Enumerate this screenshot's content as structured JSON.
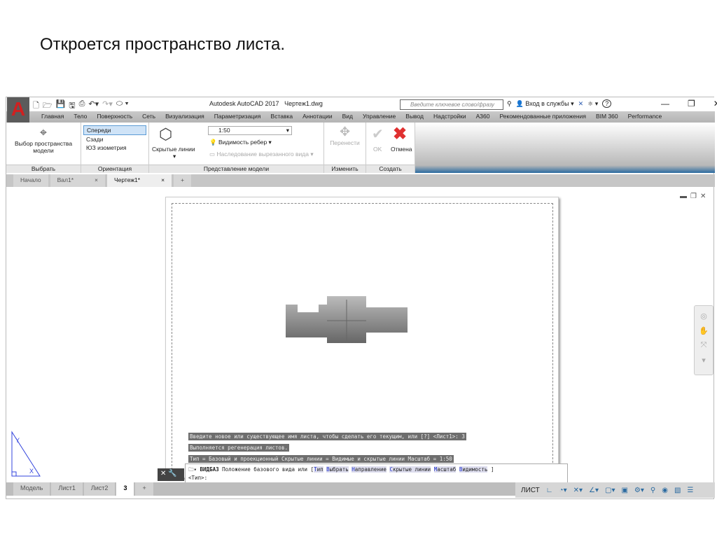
{
  "slide_title": "Откроется пространство листа.",
  "app": {
    "title": "Autodesk AutoCAD 2017",
    "file": "Чертеж1.dwg",
    "logo": "A",
    "search_placeholder": "Введите ключевое слово/фразу",
    "signin": "Вход в службы",
    "help": "?"
  },
  "menu": [
    "Главная",
    "Тело",
    "Поверхность",
    "Сеть",
    "Визуализация",
    "Параметризация",
    "Вставка",
    "Аннотации",
    "Вид",
    "Управление",
    "Вывод",
    "Надстройки",
    "A360",
    "Рекомендованные приложения",
    "BIM 360",
    "Performance"
  ],
  "ribbon": {
    "select": {
      "button": "Выбор пространства модели",
      "label": "Выбрать"
    },
    "orientation": {
      "items": [
        "Спереди",
        "Сзади",
        "ЮЗ изометрия"
      ],
      "selected": "Спереди",
      "label": "Ориентация"
    },
    "model_view": {
      "hidden_lines": "Скрытые линии",
      "scale": "1:50",
      "edge_visibility": "Видимость ребер",
      "inherit": "Наследование вырезанного вида",
      "label": "Представление модели"
    },
    "modify": {
      "move": "Перенести",
      "label": "Изменить"
    },
    "create": {
      "ok": "OK",
      "cancel": "Отмена",
      "label": "Создать"
    }
  },
  "file_tabs": [
    "Начало",
    "Вал1*",
    "Чертеж1*"
  ],
  "active_file_tab": "Чертеж1*",
  "command_history": [
    "Введите новое или существующее имя листа, чтобы сделать его текущим, или [?] <Лист1>: 3",
    "Выполняется регенерация листов.",
    "Тип = Базовый и проекционный Скрытые линии = Видимые и скрытые линии Масштаб = 1:50"
  ],
  "command_line": {
    "command": "ВИДБАЗ",
    "prompt": "Положение базового вида или [",
    "options": [
      {
        "k": "Т",
        "rest": "ип"
      },
      {
        "k": "В",
        "rest": "ыбрать"
      },
      {
        "k": "Н",
        "rest": "аправление"
      },
      {
        "k": "С",
        "rest": "крытые линии"
      },
      {
        "k": "М",
        "rest": "асштаб"
      },
      {
        "k": "В",
        "rest": "идимость"
      }
    ],
    "close": "]",
    "default": "<Тип>:"
  },
  "layout_tabs": [
    "Модель",
    "Лист1",
    "Лист2",
    "3"
  ],
  "active_layout_tab": "3",
  "status": {
    "space": "ЛИСТ"
  }
}
